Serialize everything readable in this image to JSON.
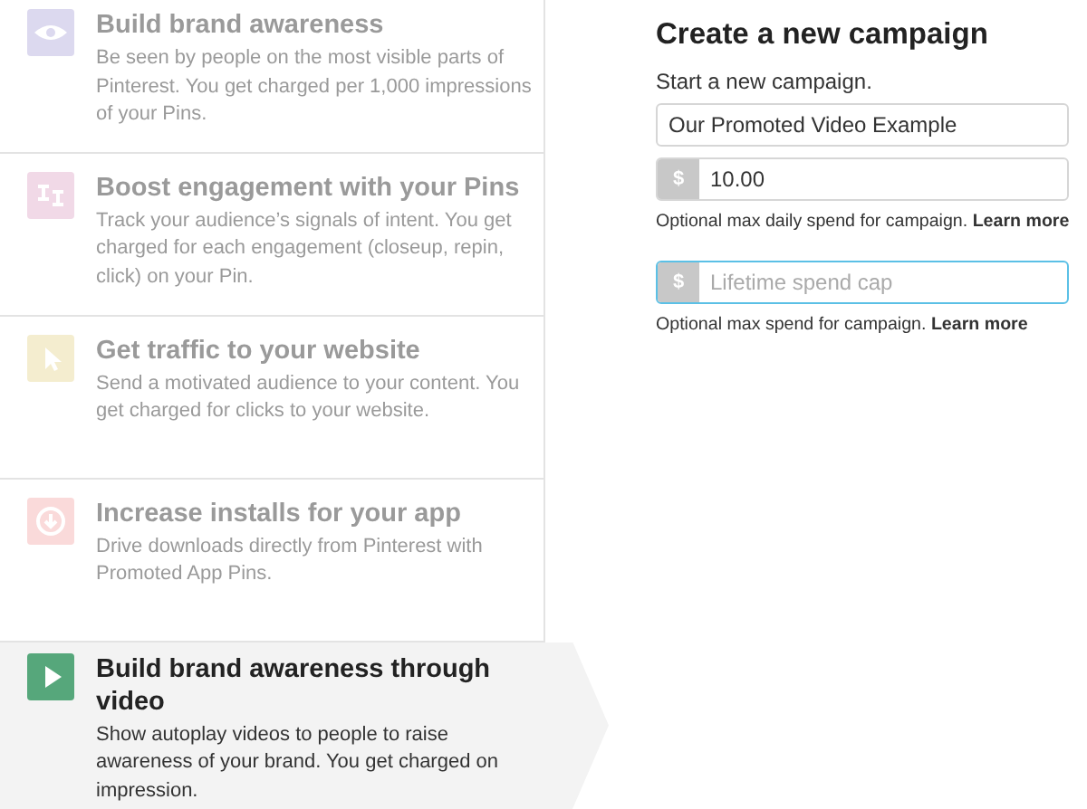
{
  "objectives": [
    {
      "kind": "eye",
      "color": "#dcd9ef",
      "title": "Build brand awareness",
      "description": "Be seen by people on the most visible parts of Pinterest. You get charged per 1,000 impressions of your Pins.",
      "selected": false
    },
    {
      "kind": "pin",
      "color": "#f1d9e7",
      "title": "Boost engagement with your Pins",
      "description": "Track your audience’s signals of intent. You get charged for each engagement (closeup, repin, click) on your Pin.",
      "selected": false
    },
    {
      "kind": "cursor",
      "color": "#f4edcf",
      "title": "Get traffic to your website",
      "description": "Send a motivated audience to your content. You get charged for clicks to your website.",
      "selected": false
    },
    {
      "kind": "download",
      "color": "#fadada",
      "title": "Increase installs for your app",
      "description": "Drive downloads directly from Pinterest with Promoted App Pins.",
      "selected": false
    },
    {
      "kind": "play",
      "color": "#56a77b",
      "title": "Build brand awareness through video",
      "description": "Show autoplay videos to people to raise awareness of your brand. You get charged on impression.",
      "selected": true
    }
  ],
  "form": {
    "title": "Create a new campaign",
    "subtitle": "Start a new campaign.",
    "name_field": {
      "value": "Our Promoted Video Example"
    },
    "daily_budget": {
      "prefix": "$",
      "value": "10.00",
      "focused": false,
      "help": "Optional max daily spend for campaign.",
      "link": "Learn more"
    },
    "lifetime_budget": {
      "prefix": "$",
      "placeholder": "Lifetime spend cap",
      "focused": true,
      "help": "Optional max spend for campaign.",
      "link": "Learn more"
    }
  }
}
